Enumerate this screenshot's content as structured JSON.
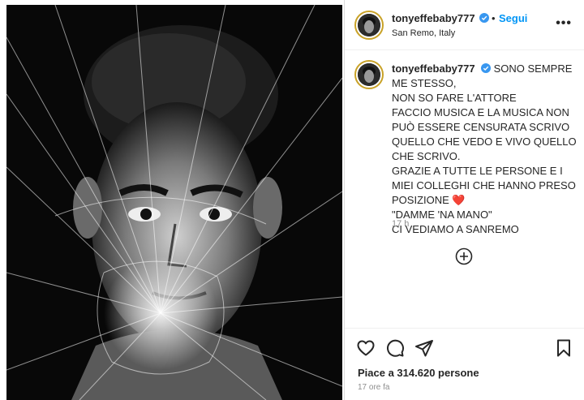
{
  "post": {
    "author": "tonyeffebaby777",
    "follow_label": "Segui",
    "separator": "•",
    "location": "San Remo, Italy",
    "more_label": "•••"
  },
  "caption": {
    "author": "tonyeffebaby777",
    "lines": [
      "SONO SEMPRE",
      "ME STESSO,",
      "NON SO FARE L'ATTORE",
      "FACCIO MUSICA E LA MUSICA NON",
      "PUÒ ESSERE CENSURATA SCRIVO",
      "QUELLO CHE VEDO E VIVO QUELLO",
      "CHE SCRIVO.",
      "GRAZIE A TUTTE LE PERSONE E I",
      "MIEI COLLEGHI CHE HANNO PRESO",
      "POSIZIONE ❤️",
      "\"DAMME 'NA MANO\"",
      "CI VEDIAMO A SANREMO"
    ],
    "time": "17 h"
  },
  "footer": {
    "likes": "Piace a 314.620 persone",
    "ago": "17 ore fa"
  },
  "colors": {
    "accent_blue": "#0095f6",
    "verified_blue": "#3897f0",
    "heart_red": "#e0245e",
    "text": "#262626",
    "muted": "#8e8e8e"
  },
  "icons": [
    "verified-badge-icon",
    "more-options-icon",
    "add-circle-icon",
    "heart-icon",
    "comment-icon",
    "share-icon",
    "bookmark-icon"
  ]
}
